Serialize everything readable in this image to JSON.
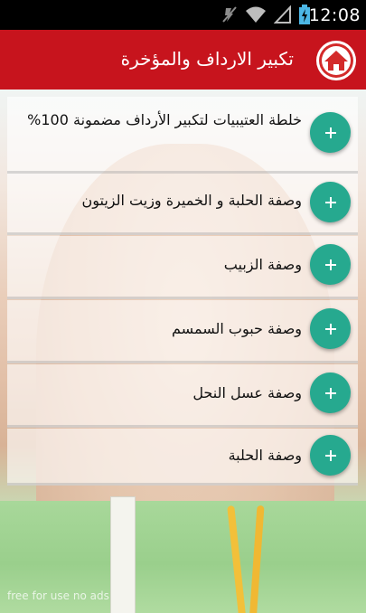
{
  "status_bar": {
    "time": "12:08",
    "icons": [
      "mute-icon",
      "wifi-icon",
      "signal-icon",
      "battery-charging-icon"
    ]
  },
  "action_bar": {
    "title": "تكبير الارداف والمؤخرة",
    "logo_icon": "home-icon",
    "color": "#c7141d"
  },
  "list": {
    "items": [
      {
        "label": "خلطة العتيبيات لتكبير الأرداف  مضمونة 100%",
        "button_icon": "plus-icon"
      },
      {
        "label": "وصفة الحلبة و الخميرة وزيت الزيتون",
        "button_icon": "plus-icon"
      },
      {
        "label": "وصفة الزبيب",
        "button_icon": "plus-icon"
      },
      {
        "label": "وصفة حبوب السمسم",
        "button_icon": "plus-icon"
      },
      {
        "label": "وصفة عسل النحل",
        "button_icon": "plus-icon"
      },
      {
        "label": "وصفة  الحلبة",
        "button_icon": "plus-icon"
      }
    ],
    "accent": "#26a98f"
  },
  "background": {
    "watermark": "free for use no ads"
  }
}
